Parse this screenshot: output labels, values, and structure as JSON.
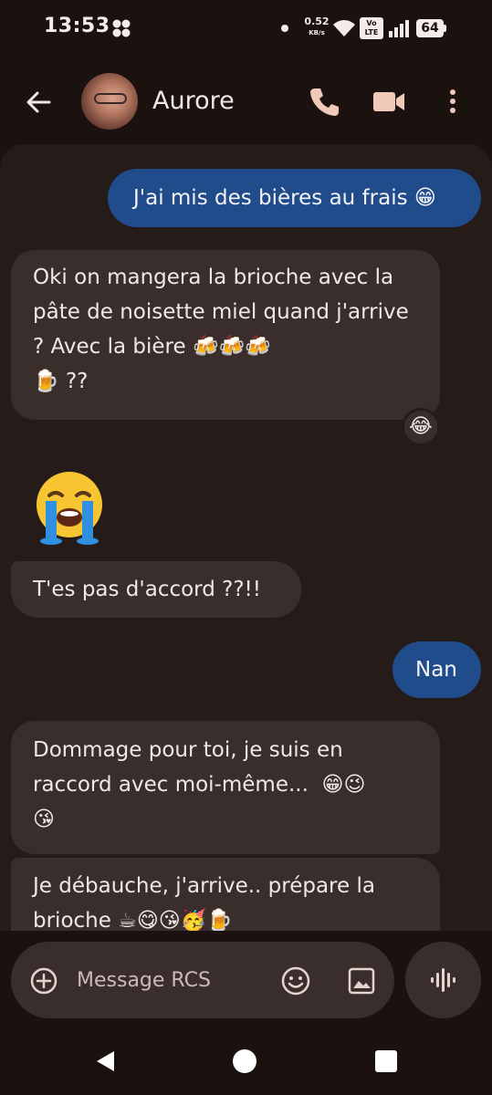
{
  "status_bar": {
    "time": "13:53",
    "net_speed_value": "0.52",
    "net_speed_unit": "KB/s",
    "volte_top": "Vo",
    "volte_bottom": "LTE",
    "battery": "64"
  },
  "header": {
    "contact_name": "Aurore",
    "icons": [
      "back-arrow-icon",
      "avatar",
      "phone-icon",
      "video-camera-icon",
      "more-vert-icon"
    ]
  },
  "messages": [
    {
      "direction": "outgoing",
      "text": "J'ai mis des bières au frais 😁"
    },
    {
      "direction": "incoming",
      "text": "Oki on mangera la brioche avec la pâte de noisette miel quand j'arrive ? Avec la bière 🍻🍻🍻\n🍺 ??",
      "reaction": "😂"
    },
    {
      "direction": "incoming",
      "text": "😭"
    },
    {
      "direction": "incoming",
      "text": "T'es pas d'accord ??!!"
    },
    {
      "direction": "outgoing",
      "text": "Nan"
    },
    {
      "direction": "incoming",
      "text": "Dommage pour toi, je suis en raccord avec moi-même...  😁😉\n😘"
    },
    {
      "direction": "incoming",
      "text": "Je débauche, j'arrive.. prépare la brioche ☕😋😘🥳🍺"
    }
  ],
  "composer": {
    "placeholder": "Message RCS"
  },
  "colors": {
    "background": "#1b1210",
    "panel": "#251b19",
    "incoming_bubble": "#3a2e2c",
    "outgoing_bubble": "#204c8c",
    "text": "#f1e7e4",
    "accent_icon": "#f0c9b8"
  }
}
